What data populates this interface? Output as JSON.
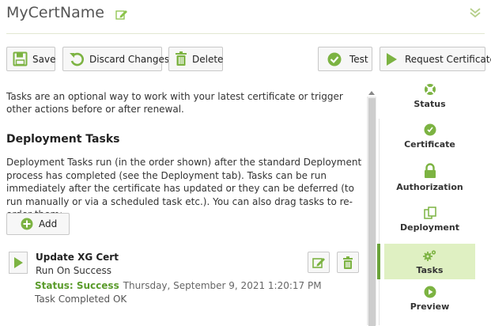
{
  "header": {
    "title": "MyCertName"
  },
  "toolbar": {
    "save_label": "Save",
    "discard_label": "Discard Changes",
    "delete_label": "Delete",
    "test_label": "Test",
    "request_label": "Request Certificate"
  },
  "intro": {
    "text": "Tasks are an optional way to work with your latest certificate or trigger other actions before or after renewal."
  },
  "deployment": {
    "title": "Deployment Tasks",
    "description": "Deployment Tasks run (in the order shown) after the standard Deployment process has completed (see the Deployment tab). Tasks can be run immediately after the certificate has updated or they can be deferred (to run manually or via a scheduled task etc.). You can also drag tasks to re-order them:",
    "add_label": "Add"
  },
  "task": {
    "name": "Update XG Cert",
    "trigger": "Run On Success",
    "status_label": "Status: Success",
    "status_time": "Thursday, September 9, 2021 1:20:17 PM",
    "result": "Task Completed OK"
  },
  "nav": {
    "items": [
      {
        "label": "Status",
        "icon": "lifebuoy-icon"
      },
      {
        "label": "Certificate",
        "icon": "certificate-icon"
      },
      {
        "label": "Authorization",
        "icon": "lock-icon"
      },
      {
        "label": "Deployment",
        "icon": "deployment-icon"
      },
      {
        "label": "Tasks",
        "icon": "gears-icon",
        "active": true
      },
      {
        "label": "Preview",
        "icon": "play-circle-icon"
      }
    ]
  },
  "colors": {
    "accent": "#6aa33a",
    "accent_light": "#dff0c2",
    "success": "#5a9b2b",
    "icon_green": "#7cb342"
  }
}
